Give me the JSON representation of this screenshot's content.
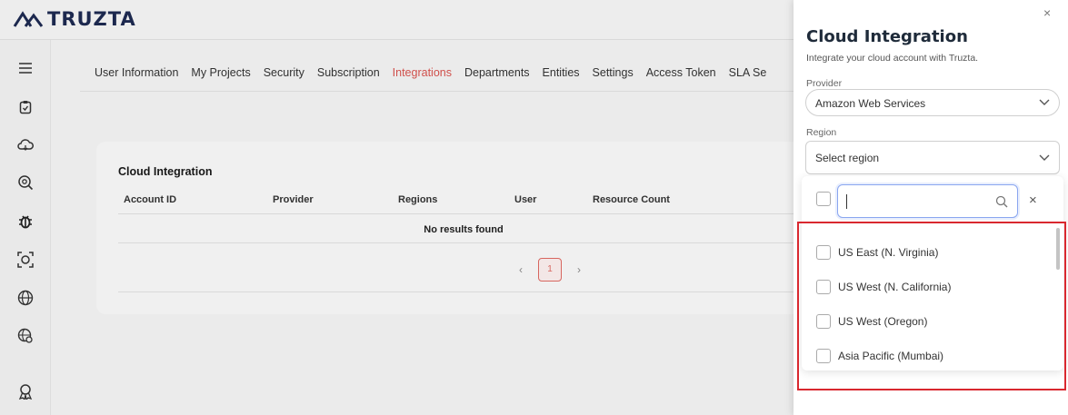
{
  "app": {
    "logo_text": "TRUZTA"
  },
  "sidebar": {
    "icons": [
      "menu-icon",
      "clipboard-icon",
      "cloud-icon",
      "scan-search-icon",
      "bug-icon",
      "focus-icon",
      "globe-icon",
      "settings-globe-icon",
      "award-icon"
    ]
  },
  "tabs": {
    "items": [
      "User Information",
      "My Projects",
      "Security",
      "Subscription",
      "Integrations",
      "Departments",
      "Entities",
      "Settings",
      "Access Token",
      "SLA Se"
    ],
    "active": "Integrations"
  },
  "card": {
    "title": "Cloud Integration",
    "columns": [
      "Account ID",
      "Provider",
      "Regions",
      "User",
      "Resource Count"
    ],
    "empty_text": "No results found",
    "pager": {
      "prev": "‹",
      "page": "1",
      "next": "›"
    }
  },
  "drawer": {
    "close": "×",
    "title": "Cloud Integration",
    "subtitle": "Integrate your cloud account with Truzta.",
    "provider_label": "Provider",
    "provider_value": "Amazon Web Services",
    "region_label": "Region",
    "region_placeholder": "Select region",
    "search_value": "",
    "clear": "×",
    "options": [
      "US East (N. Virginia)",
      "US West (N. California)",
      "US West (Oregon)",
      "Asia Pacific (Mumbai)"
    ]
  },
  "colors": {
    "accent": "#d9534f",
    "brand": "#1e2a52",
    "highlight": "#d9282f"
  }
}
